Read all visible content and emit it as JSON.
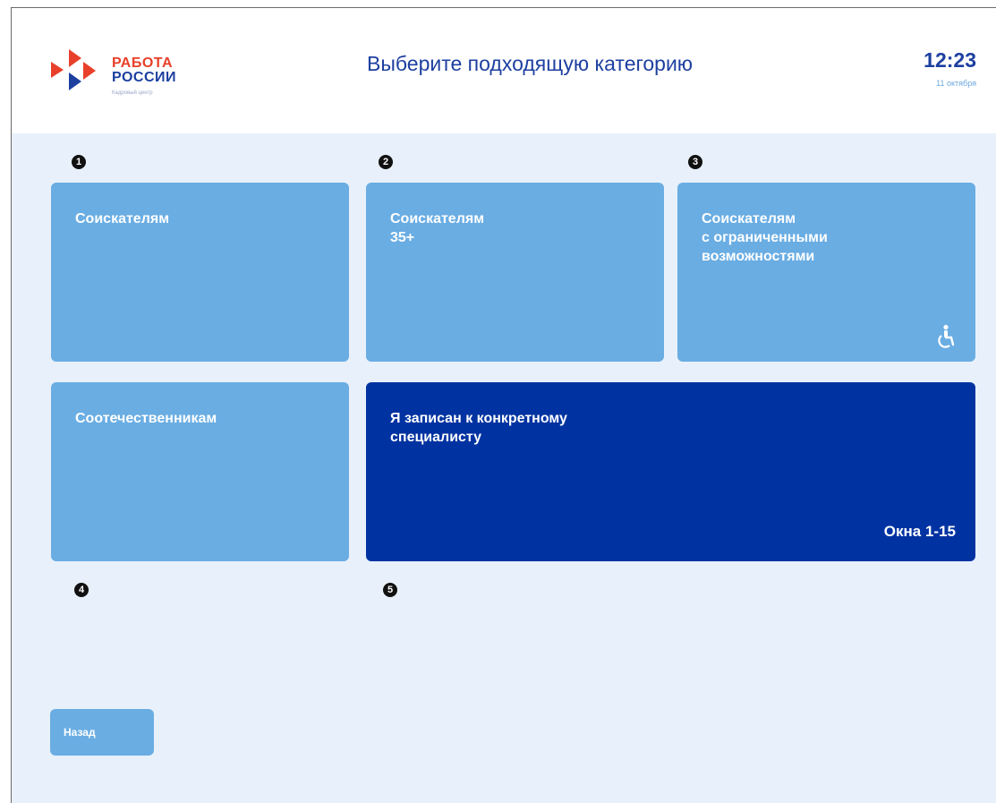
{
  "header": {
    "logo_line1": "РАБОТА",
    "logo_line2": "РОССИИ",
    "logo_sub": "Кадровый центр",
    "title": "Выберите подходящую категорию",
    "time": "12:23",
    "date": "11 октября"
  },
  "markers": [
    "1",
    "2",
    "3",
    "4",
    "5"
  ],
  "tiles": [
    {
      "label": "Соискателям"
    },
    {
      "label": "Соискателям\n35+"
    },
    {
      "label": "Соискателям\nс ограниченными\nвозможностями",
      "icon": "accessibility-icon"
    },
    {
      "label": "Соотечественникам"
    },
    {
      "label": "Я записан к конкретному\nспециалисту",
      "note": "Окна 1-15"
    }
  ],
  "back_label": "Назад",
  "colors": {
    "brand_blue": "#1d3fa0",
    "brand_red": "#e8402a",
    "tile_light": "#6aade3",
    "tile_dark": "#0033a1",
    "background": "#e8f1fb"
  }
}
